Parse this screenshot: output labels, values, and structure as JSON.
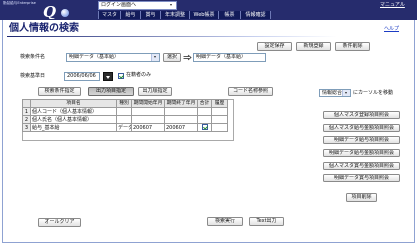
{
  "header": {
    "brand": "勤怠給与Enterprise",
    "logo_text": "Q",
    "login_select": "ログイン画面へ",
    "tabs": [
      "マスタ",
      "給与",
      "賞与",
      "年末調整",
      "Web帳票",
      "帳票",
      "情報確認"
    ],
    "manual_link": "マニュアル"
  },
  "page": {
    "title": "個人情報の検索",
    "help_link": "ヘルプ"
  },
  "toolbar": {
    "buttons": [
      "設定保存",
      "新規登録",
      "条件削除"
    ]
  },
  "search_condition": {
    "label": "検索条件名",
    "selected": "明細データ（基本給）",
    "select_button": "選択",
    "current_name": "明細データ（基本給）"
  },
  "base_date": {
    "label": "検索基準日",
    "value": "2006/06/06",
    "active_only_checked": true,
    "active_only_label": "在籍者のみ"
  },
  "mode_tabs": {
    "items": [
      "検索条件指定",
      "出力項目指定",
      "出力順指定"
    ],
    "active_index": 1
  },
  "code_lookup_button": "コード名称参照",
  "output_items": {
    "columns": [
      "項目名",
      "種別",
      "期間開始年月",
      "期間終了年月",
      "合計",
      "履歴"
    ],
    "rows": [
      {
        "no": "1",
        "name": "個人コード（個人基本情報）",
        "type": "",
        "start": "",
        "end": "",
        "total": null,
        "history": null
      },
      {
        "no": "2",
        "name": "個人氏名（個人基本情報）",
        "type": "",
        "start": "",
        "end": "",
        "total": null,
        "history": null
      },
      {
        "no": "3",
        "name": "給与_基本給",
        "type": "データ",
        "start": "200607",
        "end": "200607",
        "total": true,
        "history": null
      }
    ]
  },
  "item_panel": {
    "category_select": "情報総合",
    "move_cursor_label": "にカーソルを移動",
    "lookup_buttons": [
      "個人マスタ登録項目照会",
      "個人マスタ給与金額項目照会",
      "明細データ給与項目照会",
      "明細データ給与金額項目照会",
      "個人マスタ賞与金額項目照会",
      "明細データ賞与項目照会"
    ],
    "delete_button": "項目削除"
  },
  "footer": {
    "clear_button": "オールクリア",
    "search_button": "検索実行",
    "text_export_button": "Text出力"
  },
  "colors": {
    "header_bg": "#262c6d",
    "tabs_bg": "#121b5a",
    "title": "#1b2570",
    "frame": "#8fa2d2",
    "link": "#1c3cc4",
    "check": "#1f8a2e"
  }
}
